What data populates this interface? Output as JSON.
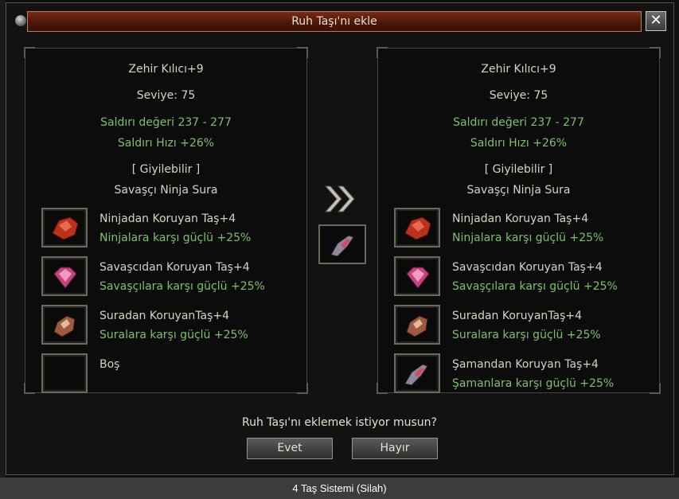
{
  "dialog": {
    "title": "Ruh Taşı'nı ekle",
    "close_glyph": "✕",
    "question": "Ruh Taşı'nı eklemek istiyor musun?",
    "yes_label": "Evet",
    "no_label": "Hayır"
  },
  "left": {
    "item_name": "Zehir Kılıcı+9",
    "level": "Seviye: 75",
    "attack_value": "Saldırı değeri 237 - 277",
    "attack_speed": "Saldırı Hızı +26%",
    "wearable": "[ Giyilebilir ]",
    "classes": "Savaşçı Ninja Sura",
    "stones": [
      {
        "name": "Ninjadan Koruyan Taş+4",
        "effect": "Ninjalara karşı güçlü +25%",
        "icon": "red-stone-icon"
      },
      {
        "name": "Savaşcıdan Koruyan Taş+4",
        "effect": "Savaşçılara karşı güçlü +25%",
        "icon": "pink-gem-icon"
      },
      {
        "name": "Suradan KoruyanTaş+4",
        "effect": "Suralara karşı güçlü +25%",
        "icon": "orange-stone-icon"
      },
      {
        "name": "Boş",
        "effect": "",
        "icon": "empty-slot"
      }
    ]
  },
  "right": {
    "item_name": "Zehir Kılıcı+9",
    "level": "Seviye: 75",
    "attack_value": "Saldırı değeri 237 - 277",
    "attack_speed": "Saldırı Hızı +26%",
    "wearable": "[ Giyilebilir ]",
    "classes": "Savaşçı Ninja Sura",
    "stones": [
      {
        "name": "Ninjadan Koruyan Taş+4",
        "effect": "Ninjalara karşı güçlü +25%",
        "icon": "red-stone-icon"
      },
      {
        "name": "Savaşcıdan Koruyan Taş+4",
        "effect": "Savaşçılara karşı güçlü +25%",
        "icon": "pink-gem-icon"
      },
      {
        "name": "Suradan KoruyanTaş+4",
        "effect": "Suralara karşı güçlü +25%",
        "icon": "orange-stone-icon"
      },
      {
        "name": "Şamandan Koruyan Taş+4",
        "effect": "Şamanlara karşı güçlü +25%",
        "icon": "shaman-stone-icon"
      }
    ]
  },
  "middle": {
    "arrow_icon": "double-chevron-right-icon",
    "stone_icon": "shaman-stone-icon"
  },
  "caption": "4 Taş Sistemi (Silah)",
  "colors": {
    "title_bar": "#5a1c0c",
    "green_text": "#7ec06e",
    "light_text": "#d8d2c2",
    "caption_bar": "#3c3c3c"
  }
}
